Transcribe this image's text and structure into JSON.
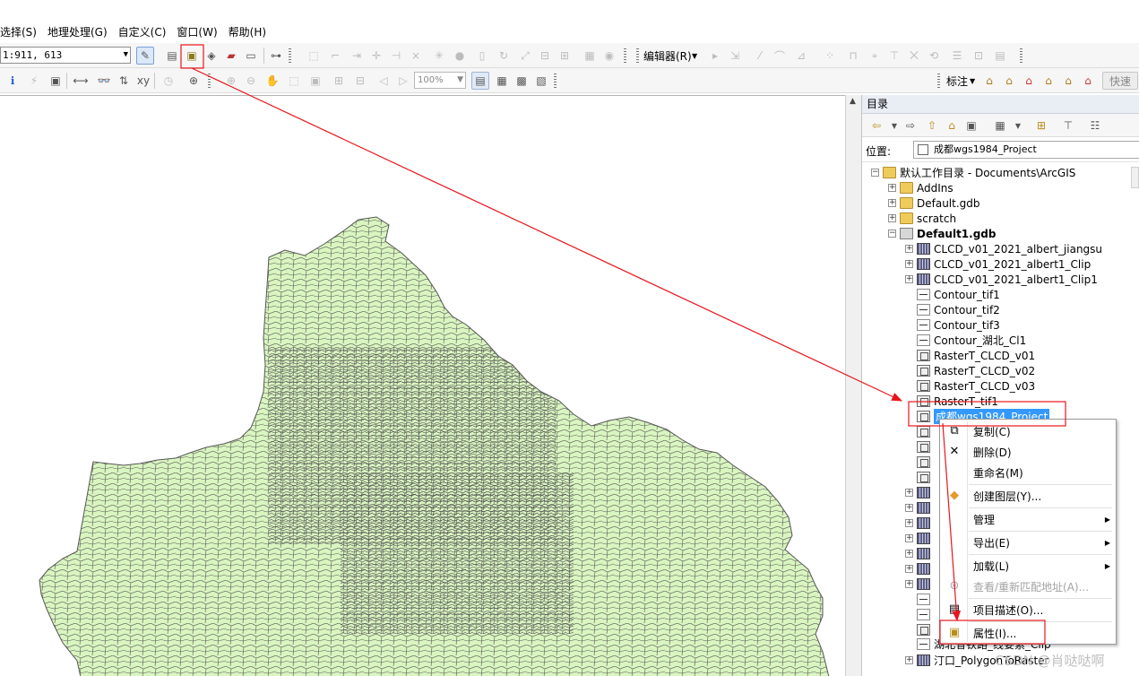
{
  "menubar": {
    "items": [
      "选择(S)",
      "地理处理(G)",
      "自定义(C)",
      "窗口(W)",
      "帮助(H)"
    ]
  },
  "toolbar1": {
    "scale_value": "1:911, 613",
    "editor_label": "编辑器(R)"
  },
  "toolbar2": {
    "zoom_value": "100%",
    "label_text": "标注",
    "quick_label": "快速"
  },
  "catalog": {
    "title": "目录",
    "location_label": "位置:",
    "location_value": "成都wgs1984_Project",
    "tree": [
      {
        "label": "默认工作目录 - Documents\\ArcGIS",
        "icon": "home-folder-icon",
        "expander": "⊟"
      },
      {
        "label": "AddIns",
        "icon": "folder-icon",
        "expander": "⊞"
      },
      {
        "label": "Default.gdb",
        "icon": "folder-icon",
        "expander": "⊞"
      },
      {
        "label": "scratch",
        "icon": "folder-icon",
        "expander": "⊞"
      },
      {
        "label": "Default1.gdb",
        "icon": "geodatabase-icon",
        "expander": "⊟"
      },
      {
        "label": "CLCD_v01_2021_albert_jiangsu",
        "icon": "raster-dataset-icon",
        "expander": "⊞"
      },
      {
        "label": "CLCD_v01_2021_albert1_Clip",
        "icon": "raster-dataset-icon",
        "expander": "⊞"
      },
      {
        "label": "CLCD_v01_2021_albert1_Clip1",
        "icon": "raster-dataset-icon",
        "expander": "⊞"
      },
      {
        "label": "Contour_tif1",
        "icon": "line-feature-class-icon",
        "expander": ""
      },
      {
        "label": "Contour_tif2",
        "icon": "line-feature-class-icon",
        "expander": ""
      },
      {
        "label": "Contour_tif3",
        "icon": "line-feature-class-icon",
        "expander": ""
      },
      {
        "label": "Contour_湖北_Cl1",
        "icon": "line-feature-class-icon",
        "expander": ""
      },
      {
        "label": "RasterT_CLCD_v01",
        "icon": "raster-layer-icon",
        "expander": ""
      },
      {
        "label": "RasterT_CLCD_v02",
        "icon": "raster-layer-icon",
        "expander": ""
      },
      {
        "label": "RasterT_CLCD_v03",
        "icon": "raster-layer-icon",
        "expander": ""
      },
      {
        "label": "RasterT_tif1",
        "icon": "raster-layer-icon",
        "expander": ""
      },
      {
        "label": "成都wgs1984_Project",
        "icon": "raster-layer-icon",
        "expander": "",
        "selected": true
      },
      {
        "label": "湖北省铁路_线要素_Clip",
        "icon": "line-feature-class-icon",
        "expander": ""
      },
      {
        "label": "汀口_PolygonToRaster",
        "icon": "raster-dataset-icon",
        "expander": "⊞"
      }
    ]
  },
  "context_menu": {
    "items": [
      {
        "label": "复制(C)",
        "icon": "copy-icon"
      },
      {
        "label": "删除(D)",
        "icon": "delete-icon"
      },
      {
        "label": "重命名(M)",
        "icon": "rename-icon"
      },
      {
        "label": "创建图层(Y)...",
        "icon": "create-layer-icon"
      },
      {
        "label": "管理",
        "icon": "",
        "submenu": true
      },
      {
        "label": "导出(E)",
        "icon": "",
        "submenu": true
      },
      {
        "label": "加载(L)",
        "icon": "",
        "submenu": true
      },
      {
        "label": "查看/重新匹配地址(A)...",
        "icon": "geocode-icon",
        "disabled": true
      },
      {
        "label": "项目描述(O)...",
        "icon": "item-description-icon"
      },
      {
        "label": "属性(I)...",
        "icon": "properties-icon"
      }
    ]
  },
  "watermark": "CSDN @肖哒哒啊",
  "colors": {
    "map_fill": "#d9f5c0",
    "map_stroke": "#555555",
    "annotation_red": "#e8161c",
    "selection_blue": "#3399ff"
  }
}
